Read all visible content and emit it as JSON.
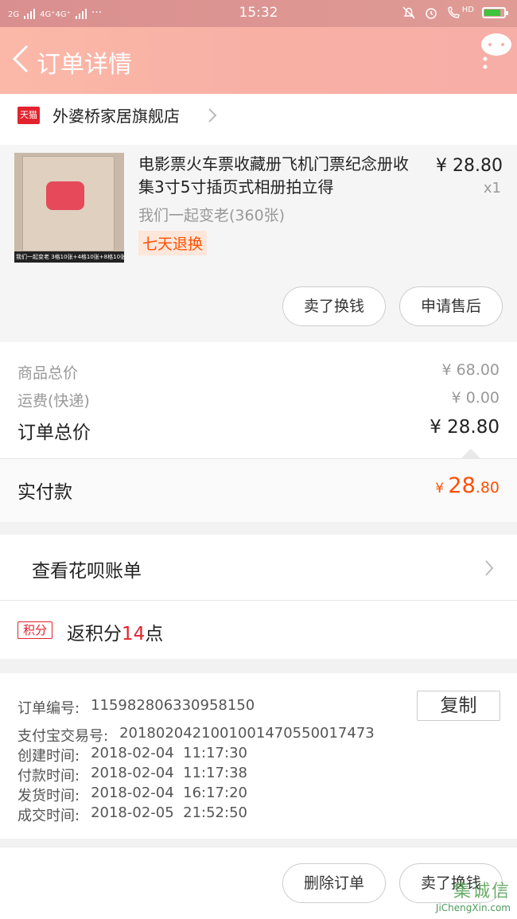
{
  "status_bar": {
    "network_left": "2G",
    "network_right": "4G⁺4G⁺",
    "dots": "···",
    "time": "15:32",
    "hd": "HD"
  },
  "header": {
    "title": "订单详情"
  },
  "shop": {
    "badge": "天猫",
    "name": "外婆桥家居旗舰店"
  },
  "item": {
    "title": "电影票火车票收藏册飞机门票纪念册收集3寸5寸插页式相册拍立得",
    "price": "¥ 28.80",
    "qty": "x1",
    "spec": "我们一起变老(360张)",
    "tag": "七天退换",
    "thumb_caption": "我们一起变老 3格10张+4格10张+8格10张",
    "buttons": {
      "sell": "卖了换钱",
      "after_sale": "申请售后"
    }
  },
  "prices": {
    "goods_label": "商品总价",
    "goods_value": "¥ 68.00",
    "shipping_label": "运费(快递)",
    "shipping_value": "¥ 0.00",
    "total_label": "订单总价",
    "total_value": "¥ 28.80",
    "paid_label": "实付款",
    "paid_currency": "¥ ",
    "paid_int": "28",
    "paid_dec": ".80"
  },
  "huabei": {
    "label": "查看花呗账单"
  },
  "points": {
    "badge": "积分",
    "prefix": "返积分",
    "num": "14",
    "suffix": "点"
  },
  "order_info": {
    "order_no_label": "订单编号:",
    "order_no": "115982806330958150",
    "alipay_label": "支付宝交易号:",
    "alipay_no": "2018020421001001470550017473",
    "created_label": "创建时间:",
    "created": "2018-02-04  11:17:30",
    "paid_label": "付款时间:",
    "paid": "2018-02-04  11:17:38",
    "shipped_label": "发货时间:",
    "shipped": "2018-02-04  16:17:20",
    "done_label": "成交时间:",
    "done": "2018-02-05  21:52:50",
    "copy_button": "复制"
  },
  "footer": {
    "delete": "删除订单",
    "sell": "卖了换钱"
  },
  "watermark": {
    "text": "集诚信",
    "url": "JiChengXin.com"
  },
  "colors": {
    "accent": "#ff5000",
    "tmall_red": "#e2232d",
    "header": "#f8b0a5"
  }
}
